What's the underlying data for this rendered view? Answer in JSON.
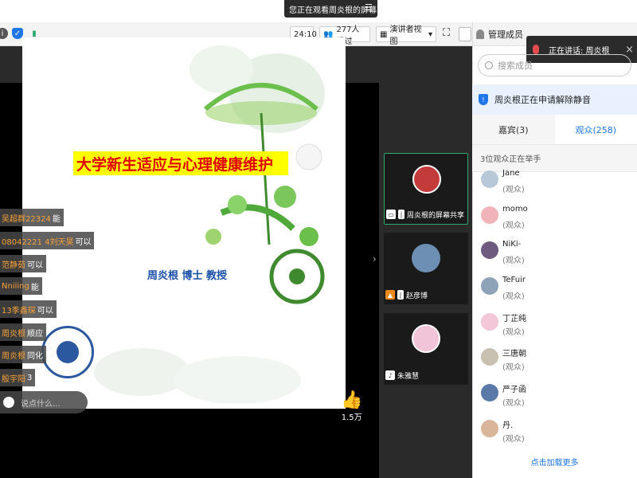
{
  "banner": {
    "text": "您正在观看周炎根的屏幕",
    "menu_icon": "menu-icon"
  },
  "toolbar": {
    "timer": "24:10",
    "viewers": "277人看过",
    "view_mode": "演讲者视图",
    "view_mode_caret": "▾"
  },
  "panel": {
    "title": "管理成员",
    "speaking": "正在讲话: 周炎根",
    "search_placeholder": "搜索成员",
    "notice": "周炎根正在申请解除静音",
    "tabs": [
      {
        "label": "嘉宾(3)"
      },
      {
        "label": "观众(258)"
      }
    ],
    "hands_raised": "3位观众正在举手",
    "members": [
      {
        "name": "Jane",
        "role": "(观众)",
        "color": "#b7c9d8"
      },
      {
        "name": "momo",
        "role": "(观众)",
        "color": "#f0b4b8"
      },
      {
        "name": "NiKi-",
        "role": "(观众)",
        "color": "#6d5a7e"
      },
      {
        "name": "TeFuir",
        "role": "(观众)",
        "color": "#8ea2b8"
      },
      {
        "name": "丁芷纯",
        "role": "(观众)",
        "color": "#f3c7d8"
      },
      {
        "name": "三唐朝",
        "role": "(观众)",
        "color": "#c8c0b0"
      },
      {
        "name": "严子函",
        "role": "(观众)",
        "color": "#5a79a8"
      },
      {
        "name": "丹.",
        "role": "(观众)",
        "color": "#d9b59a"
      }
    ],
    "load_more": "点击加载更多"
  },
  "slide": {
    "title": "大学新生适应与心理健康维护",
    "author": "周炎根   博士 教授"
  },
  "likes": "1.5万",
  "chat": {
    "messages": [
      {
        "name": "吴超群22324",
        "text": "能"
      },
      {
        "name": "08042221 4刘天昊",
        "text": "可以"
      },
      {
        "name": "范静茹",
        "text": "可以"
      },
      {
        "name": "Nniiing",
        "text": "能"
      },
      {
        "name": "13季鑫琛",
        "text": "可以"
      },
      {
        "name": "周炎根",
        "text": "顺应"
      },
      {
        "name": "周炎根",
        "text": "同化"
      },
      {
        "name": "殷宇阳",
        "text": "3"
      }
    ],
    "input_placeholder": "说点什么..."
  },
  "gallery": [
    {
      "label": "周炎根的屏幕共享",
      "color": "#c43b3b",
      "icon": "screen-share-icon"
    },
    {
      "label": "赵彦博",
      "color": "#6d8fb3",
      "icon": "user-icon"
    },
    {
      "label": "朱雅慧",
      "color": "#f2c4d8",
      "icon": "mic-icon"
    }
  ]
}
